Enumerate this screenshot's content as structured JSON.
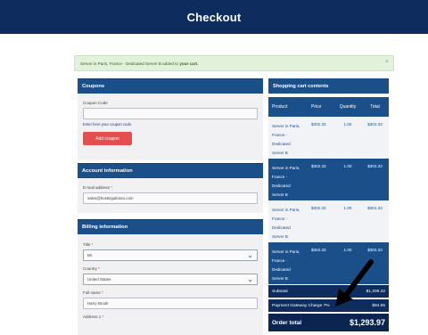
{
  "header": {
    "title": "Checkout"
  },
  "alert": {
    "message_prefix": "Server in Paris, France - Dedicated Server B added to ",
    "message_link": "your cart.",
    "close": "×"
  },
  "coupons": {
    "title": "Coupons",
    "code_label": "Coupon Code",
    "code_value": "",
    "help": "Enter here your coupon code.",
    "button": "Add coupon"
  },
  "account": {
    "title": "Account information",
    "email_label": "E-mail address",
    "email_value": "sales@hostingultraso.com"
  },
  "billing": {
    "title": "Billing information",
    "title_label": "Title",
    "title_value": "Mr.",
    "country_label": "Country",
    "country_value": "United States",
    "fullname_label": "Full name",
    "fullname_value": "Harry Brook",
    "address_label": "Address 1"
  },
  "cart": {
    "title": "Shopping cart contents",
    "columns": [
      "Product",
      "Price",
      "Quantity",
      "Total"
    ],
    "rows": [
      {
        "product": [
          "Server in Paris,",
          "France -",
          "Dedicated",
          "Server B"
        ],
        "price": "$302.33",
        "qty": "1.00",
        "total": "$302.33"
      },
      {
        "product": [
          "Server in Paris,",
          "France -",
          "Dedicated",
          "Server B"
        ],
        "price": "$302.33",
        "qty": "1.00",
        "total": "$302.33"
      },
      {
        "product": [
          "Server in Paris,",
          "France -",
          "Dedicated",
          "Server B"
        ],
        "price": "$302.33",
        "qty": "1.00",
        "total": "$302.33"
      },
      {
        "product": [
          "Server in Paris,",
          "France -",
          "Dedicated",
          "Server B"
        ],
        "price": "$302.33",
        "qty": "1.00",
        "total": "$302.33"
      }
    ],
    "subtotal_label": "Subtotal",
    "subtotal_value": "$1,209.32",
    "gateway_label": "Payment Gateway Charge 7%",
    "gateway_value": "$84.65",
    "order_total_label": "Order total",
    "order_total_value": "$1,293.97"
  },
  "colors": {
    "header": "#0e2d5e",
    "panel_head": "#1a4f8a",
    "button": "#e54e4e",
    "alert_bg": "#e2f1d9"
  },
  "icons": {
    "select_chevron": "chevron-down-icon",
    "close": "close-icon",
    "annotation": "arrow-annotation-icon"
  }
}
